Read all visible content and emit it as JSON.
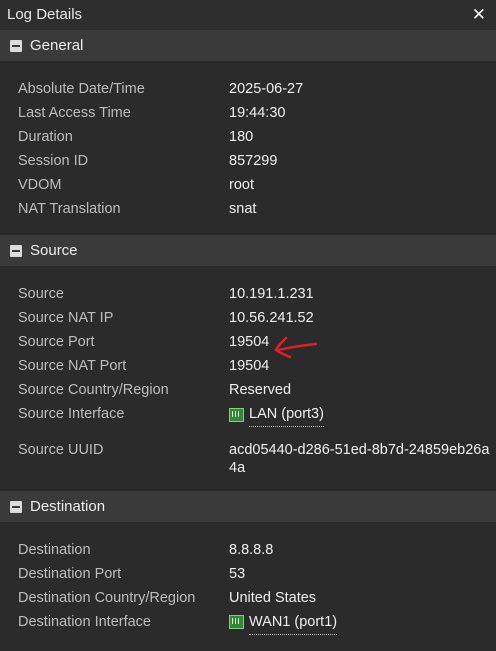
{
  "window": {
    "title": "Log Details",
    "close_icon": "close-icon"
  },
  "sections": {
    "general": {
      "title": "General",
      "rows": [
        {
          "key": "Absolute Date/Time",
          "value": "2025-06-27"
        },
        {
          "key": "Last Access Time",
          "value": "19:44:30"
        },
        {
          "key": "Duration",
          "value": "180"
        },
        {
          "key": "Session ID",
          "value": "857299"
        },
        {
          "key": "VDOM",
          "value": "root"
        },
        {
          "key": "NAT Translation",
          "value": "snat"
        }
      ]
    },
    "source": {
      "title": "Source",
      "rows": [
        {
          "key": "Source",
          "value": "10.191.1.231"
        },
        {
          "key": "Source NAT IP",
          "value": "10.56.241.52"
        },
        {
          "key": "Source Port",
          "value": "19504"
        },
        {
          "key": "Source NAT Port",
          "value": "19504"
        },
        {
          "key": "Source Country/Region",
          "value": "Reserved"
        },
        {
          "key": "Source Interface",
          "value": "LAN (port3)",
          "icon": "network-interface-icon"
        },
        {
          "key": "Source UUID",
          "value": "acd05440-d286-51ed-8b7d-24859eb26a4a"
        }
      ]
    },
    "destination": {
      "title": "Destination",
      "rows": [
        {
          "key": "Destination",
          "value": "8.8.8.8"
        },
        {
          "key": "Destination Port",
          "value": "53"
        },
        {
          "key": "Destination Country/Region",
          "value": "United States"
        },
        {
          "key": "Destination Interface",
          "value": "WAN1 (port1)",
          "icon": "network-interface-icon"
        }
      ]
    }
  },
  "colors": {
    "background": "#2b2b2b",
    "header": "#3a3a3a",
    "interface_icon": "#2f8a33",
    "annotation": "#e02020"
  }
}
